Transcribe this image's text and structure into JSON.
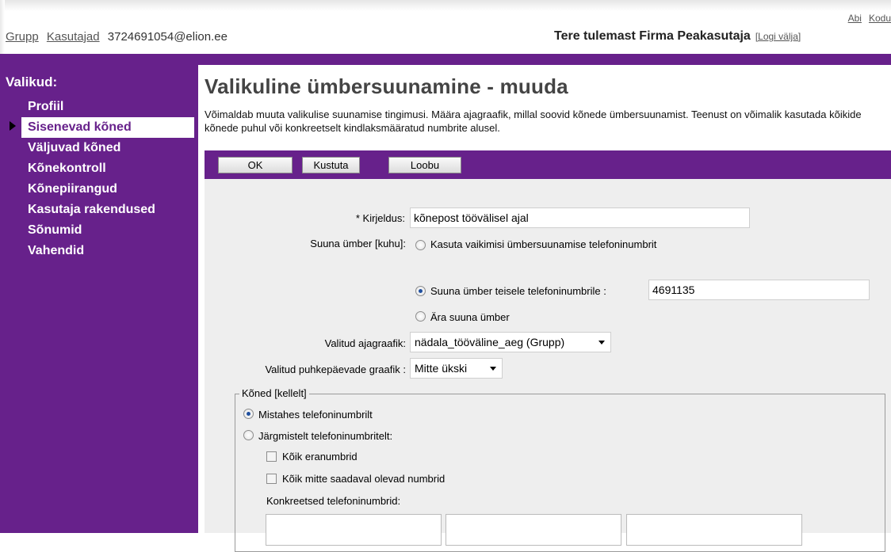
{
  "header": {
    "links": [
      "Abi",
      "Kodu"
    ],
    "nav": [
      "Grupp",
      "Kasutajad"
    ],
    "account": "3724691054@elion.ee",
    "welcome": "Tere tulemast Firma Peakasutaja",
    "logout": "[Logi välja]"
  },
  "sidebar": {
    "title": "Valikud:",
    "items": [
      "Profiil",
      "Sisenevad kõned",
      "Väljuvad kõned",
      "Kõnekontroll",
      "Kõnepiirangud",
      "Kasutaja rakendused",
      "Sõnumid",
      "Vahendid"
    ],
    "active": "Sisenevad kõned"
  },
  "page": {
    "title": "Valikuline ümbersuunamine - muuda",
    "description": "Võimaldab muuta valikulise suunamise tingimusi. Määra ajagraafik, millal soovid kõnede ümbersuunamist. Teenust on võimalik kasutada kõikide kõnede puhul või konkreetselt kindlaksmääratud numbrite alusel."
  },
  "toolbar": {
    "ok": "OK",
    "delete": "Kustuta",
    "cancel": "Loobu"
  },
  "form": {
    "description_label": "* Kirjeldus:",
    "description_value": "kõnepost töövälisel ajal",
    "redirect_label": "Suuna ümber [kuhu]:",
    "redirect_options": [
      "Kasuta vaikimisi ümbersuunamise telefoninumbrit",
      "Suuna ümber teisele telefoninumbrile :",
      "Ära suuna ümber"
    ],
    "redirect_selected": 1,
    "redirect_number": "4691135",
    "schedule_label": "Valitud ajagraafik:",
    "schedule_value": "nädala_tööväline_aeg (Grupp)",
    "holiday_label": "Valitud puhkepäevade graafik :",
    "holiday_value": "Mitte ükski",
    "calls_legend": "Kõned [kellelt]",
    "calls_options": [
      "Mistahes telefoninumbrilt",
      "Järgmistelt telefoninumbritelt:"
    ],
    "calls_selected": 0,
    "checkboxes": [
      "Kõik eranumbrid",
      "Kõik mitte saadaval olevad numbrid"
    ],
    "specific_label": "Konkreetsed telefoninumbrid:"
  }
}
